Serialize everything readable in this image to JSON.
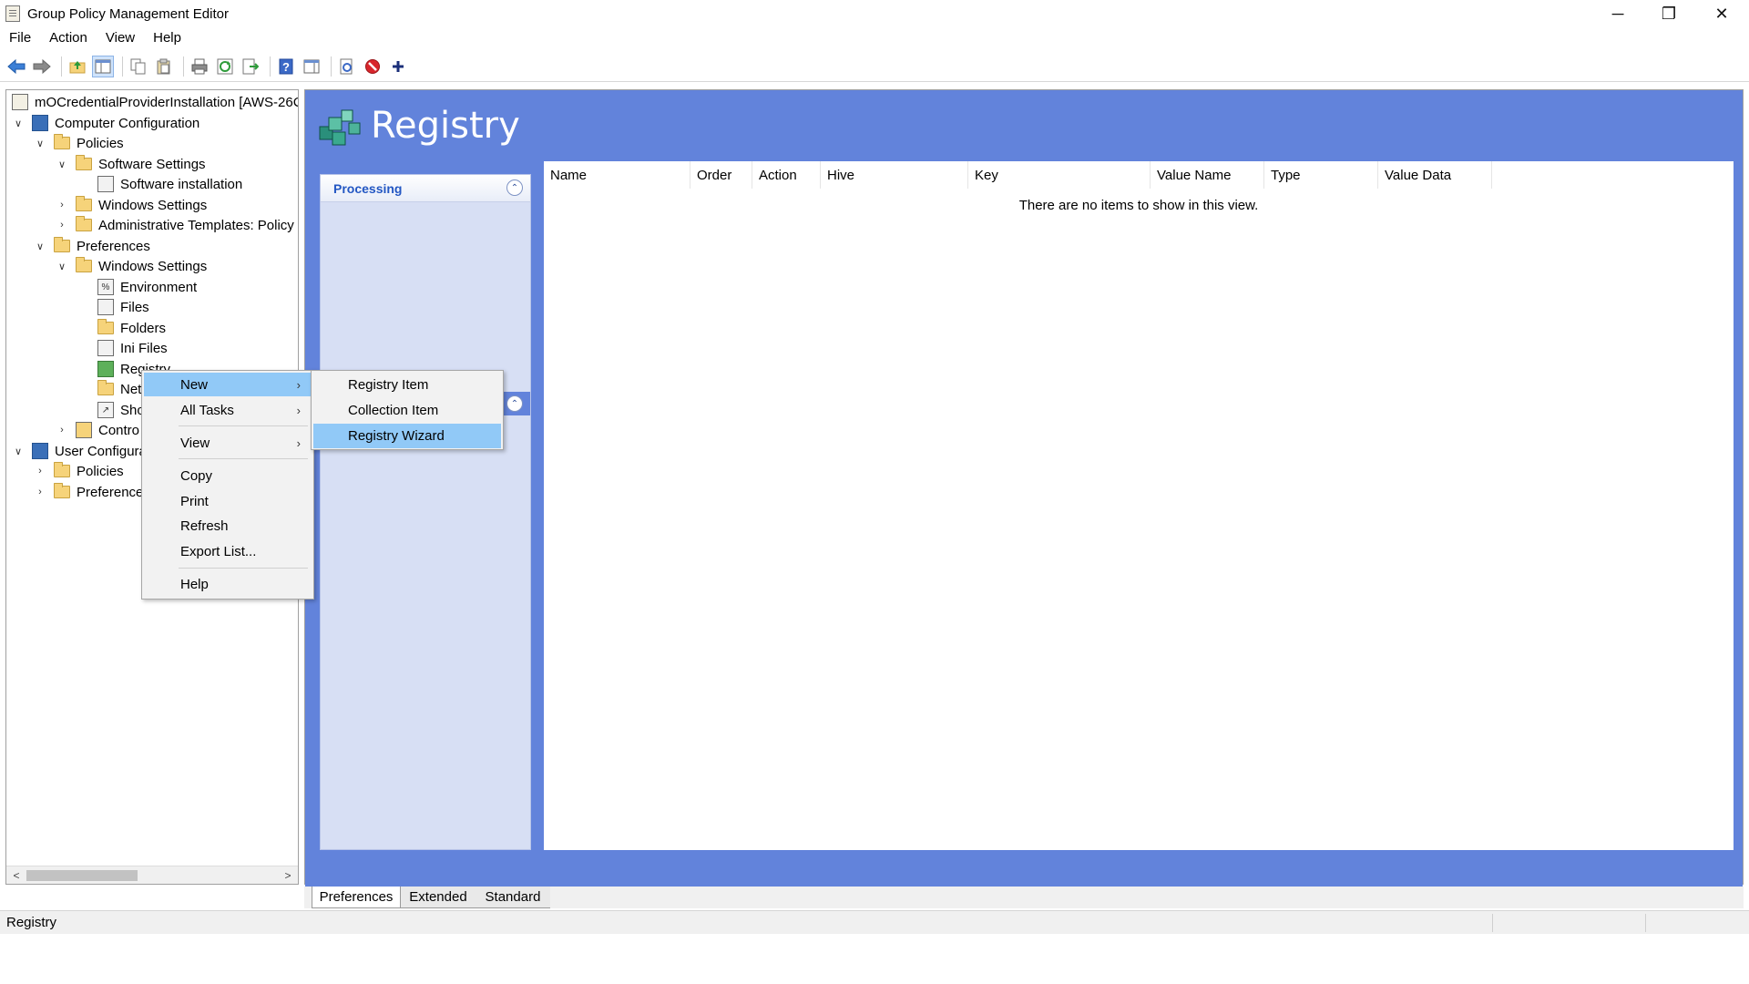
{
  "window": {
    "title": "Group Policy Management Editor",
    "controls": {
      "minimize": "─",
      "maximize": "❐",
      "close": "✕"
    }
  },
  "menubar": [
    "File",
    "Action",
    "View",
    "Help"
  ],
  "toolbar": {
    "icons": [
      "back-icon",
      "forward-icon",
      "up-folder-icon",
      "show-tree-icon",
      "copy-icon",
      "paste-icon",
      "print-icon",
      "refresh-icon",
      "export-icon",
      "help-icon",
      "show-action-pane-icon",
      "properties-icon",
      "stop-icon",
      "add-icon"
    ]
  },
  "tree": {
    "nodes": [
      {
        "label": "mOCredentialProviderInstallation [AWS-26C",
        "expander": "",
        "icon": "gpo-icon"
      },
      {
        "label": "Computer Configuration",
        "expander": "∨",
        "icon": "computer-icon"
      },
      {
        "label": "Policies",
        "expander": "∨",
        "icon": "folder-icon"
      },
      {
        "label": "Software Settings",
        "expander": "∨",
        "icon": "folder-icon"
      },
      {
        "label": "Software installation",
        "expander": "",
        "icon": "software-install-icon"
      },
      {
        "label": "Windows Settings",
        "expander": "›",
        "icon": "folder-icon"
      },
      {
        "label": "Administrative Templates: Policy",
        "expander": "›",
        "icon": "folder-icon"
      },
      {
        "label": "Preferences",
        "expander": "∨",
        "icon": "folder-icon"
      },
      {
        "label": "Windows Settings",
        "expander": "∨",
        "icon": "folder-icon"
      },
      {
        "label": "Environment",
        "expander": "",
        "icon": "environment-icon"
      },
      {
        "label": "Files",
        "expander": "",
        "icon": "files-icon"
      },
      {
        "label": "Folders",
        "expander": "",
        "icon": "folders-icon"
      },
      {
        "label": "Ini Files",
        "expander": "",
        "icon": "ini-files-icon"
      },
      {
        "label": "Registry",
        "expander": "",
        "icon": "registry-icon"
      },
      {
        "label": "Net",
        "expander": "",
        "icon": "network-shares-icon"
      },
      {
        "label": "Sho",
        "expander": "",
        "icon": "shortcuts-icon"
      },
      {
        "label": "Contro",
        "expander": "›",
        "icon": "control-panel-icon"
      },
      {
        "label": "User Configura",
        "expander": "∨",
        "icon": "user-icon"
      },
      {
        "label": "Policies",
        "expander": "›",
        "icon": "folder-icon"
      },
      {
        "label": "Preference",
        "expander": "›",
        "icon": "folder-icon"
      }
    ],
    "scroll_left": "<",
    "scroll_right": ">"
  },
  "content": {
    "title": "Registry",
    "processing_label": "Processing",
    "collapse_glyph": "⌃",
    "columns": [
      "Name",
      "Order",
      "Action",
      "Hive",
      "Key",
      "Value Name",
      "Type",
      "Value Data"
    ],
    "empty_message": "There are no items to show in this view."
  },
  "tabs": [
    "Preferences",
    "Extended",
    "Standard"
  ],
  "status": {
    "text": "Registry"
  },
  "context_menu": {
    "items": [
      {
        "label": "New",
        "arrow": "›",
        "highlighted": true
      },
      {
        "label": "All Tasks",
        "arrow": "›",
        "highlighted": false
      },
      {
        "label": "View",
        "arrow": "›",
        "highlighted": false
      },
      {
        "label": "Copy",
        "arrow": "",
        "highlighted": false
      },
      {
        "label": "Print",
        "arrow": "",
        "highlighted": false
      },
      {
        "label": "Refresh",
        "arrow": "",
        "highlighted": false
      },
      {
        "label": "Export List...",
        "arrow": "",
        "highlighted": false
      },
      {
        "label": "Help",
        "arrow": "",
        "highlighted": false
      }
    ]
  },
  "submenu": {
    "items": [
      {
        "label": "Registry Item",
        "highlighted": false
      },
      {
        "label": "Collection Item",
        "highlighted": false
      },
      {
        "label": "Registry Wizard",
        "highlighted": true
      }
    ]
  },
  "colors": {
    "banner": "#6283db",
    "processing_panel": "#d7dff4",
    "menu_highlight": "#91c9f7",
    "processing_text": "#2357c3"
  }
}
